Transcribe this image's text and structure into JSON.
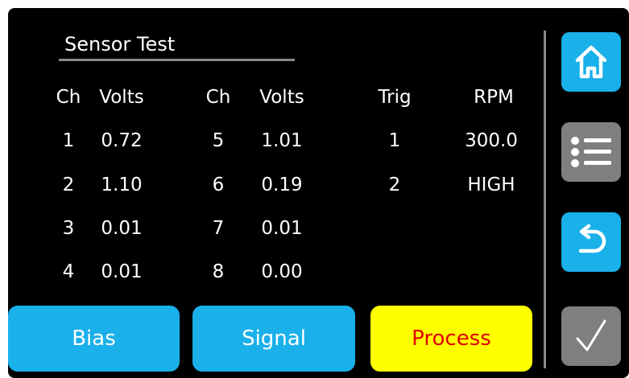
{
  "title": "Sensor Test",
  "headers": {
    "ch1": "Ch",
    "volts1": "Volts",
    "ch2": "Ch",
    "volts2": "Volts",
    "trig": "Trig",
    "rpm": "RPM"
  },
  "channels_left": [
    {
      "ch": "1",
      "volts": "0.72"
    },
    {
      "ch": "2",
      "volts": "1.10"
    },
    {
      "ch": "3",
      "volts": "0.01"
    },
    {
      "ch": "4",
      "volts": "0.01"
    }
  ],
  "channels_right": [
    {
      "ch": "5",
      "volts": "1.01"
    },
    {
      "ch": "6",
      "volts": "0.19"
    },
    {
      "ch": "7",
      "volts": "0.01"
    },
    {
      "ch": "8",
      "volts": "0.00"
    }
  ],
  "triggers": [
    {
      "trig": "1",
      "rpm": "300.0"
    },
    {
      "trig": "2",
      "rpm": "HIGH"
    }
  ],
  "buttons": {
    "bias": "Bias",
    "signal": "Signal",
    "process": "Process"
  },
  "side_icons": {
    "home": "home-icon",
    "menu": "list-icon",
    "back": "back-arrow-icon",
    "confirm": "checkmark-icon"
  },
  "colors": {
    "background": "#000000",
    "button_blue": "#1ab0ea",
    "button_yellow": "#ffff00",
    "process_text": "#e00000",
    "button_gray": "#7f7f7f"
  }
}
